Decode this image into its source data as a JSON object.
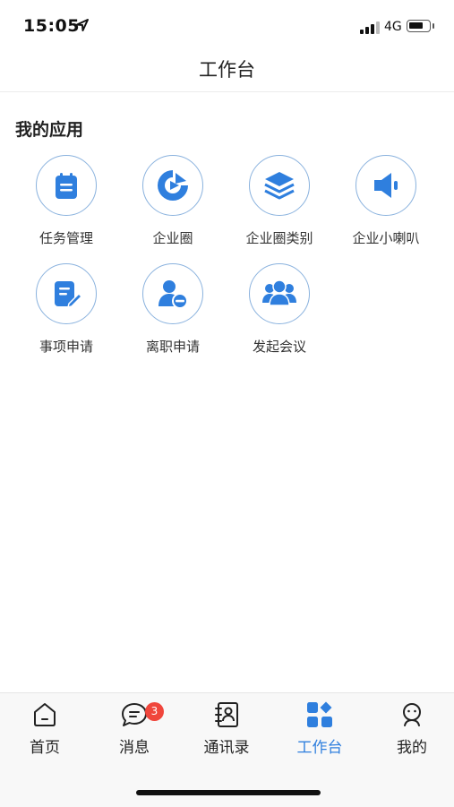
{
  "status_bar": {
    "time": "15:05",
    "network": "4G"
  },
  "header": {
    "title": "工作台"
  },
  "section": {
    "title": "我的应用"
  },
  "apps": [
    {
      "label": "任务管理",
      "icon": "task-clipboard-icon"
    },
    {
      "label": "企业圈",
      "icon": "circle-play-icon"
    },
    {
      "label": "企业圈类别",
      "icon": "layers-icon"
    },
    {
      "label": "企业小喇叭",
      "icon": "speaker-icon"
    },
    {
      "label": "事项申请",
      "icon": "edit-document-icon"
    },
    {
      "label": "离职申请",
      "icon": "user-remove-icon"
    },
    {
      "label": "发起会议",
      "icon": "group-users-icon"
    }
  ],
  "tabbar": {
    "items": [
      {
        "label": "首页",
        "icon": "home-icon"
      },
      {
        "label": "消息",
        "icon": "message-icon",
        "badge": "3"
      },
      {
        "label": "通讯录",
        "icon": "contacts-icon"
      },
      {
        "label": "工作台",
        "icon": "grid-apps-icon",
        "active": true
      },
      {
        "label": "我的",
        "icon": "profile-icon"
      }
    ]
  },
  "colors": {
    "accent": "#2f7fde",
    "badge": "#f0463c",
    "icon_border": "#8ab2de"
  }
}
